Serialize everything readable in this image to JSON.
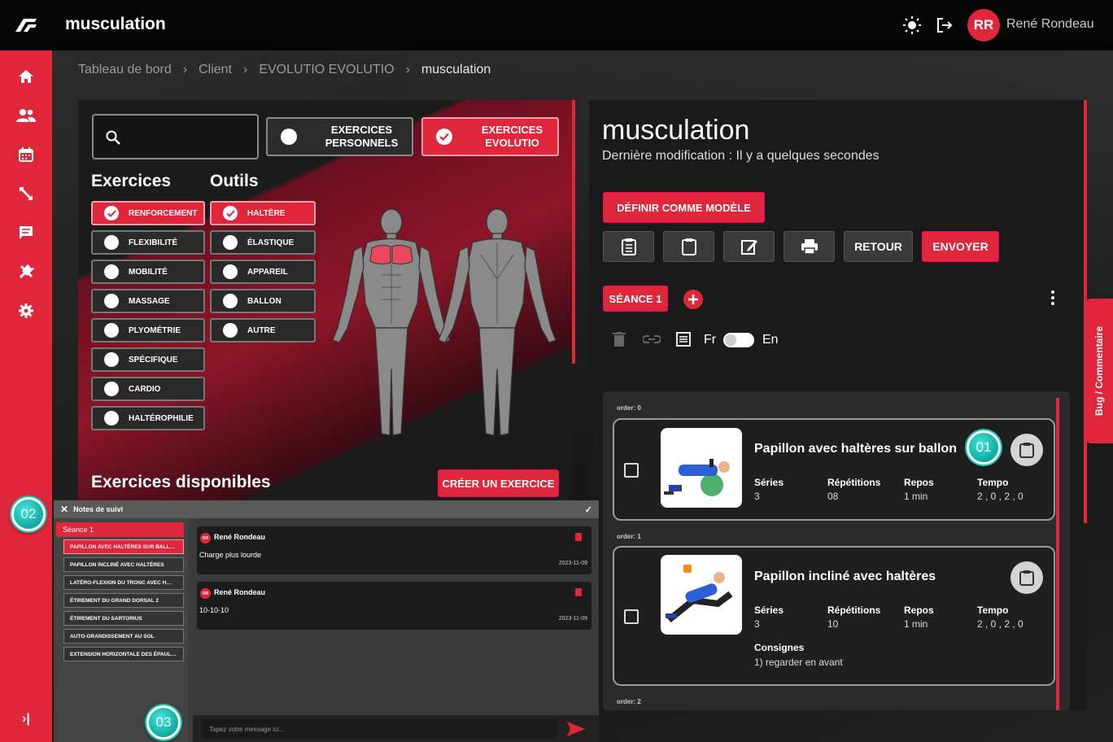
{
  "app": {
    "name": "musculation",
    "user_initials": "RR",
    "user_name": "René Rondeau"
  },
  "icons": {
    "logo": "brand-logo",
    "theme": "sun-icon",
    "logout": "logout-icon"
  },
  "sidebar": {
    "items": [
      {
        "icon": "home-icon"
      },
      {
        "icon": "clients-icon"
      },
      {
        "icon": "calendar-icon"
      },
      {
        "icon": "resize-icon"
      },
      {
        "icon": "message-icon"
      },
      {
        "icon": "tools-icon"
      },
      {
        "icon": "settings-icon"
      }
    ],
    "collapse": "›|"
  },
  "breadcrumb": [
    "Tableau de bord",
    "Client",
    "EVOLUTIO EVOLUTIO",
    "musculation"
  ],
  "breadcrumb_sep": "›",
  "library": {
    "toggle_personal": "EXERCICES PERSONNELS",
    "toggle_evolutio": "EXERCICES EVOLUTIO",
    "exercices_title": "Exercices",
    "outils_title": "Outils",
    "exercices": [
      {
        "label": "RENFORCEMENT",
        "checked": true
      },
      {
        "label": "FLEXIBILITÉ",
        "checked": false
      },
      {
        "label": "MOBILITÉ",
        "checked": false
      },
      {
        "label": "MASSAGE",
        "checked": false
      },
      {
        "label": "PLYOMÉTRIE",
        "checked": false
      },
      {
        "label": "SPÉCIFIQUE",
        "checked": false
      },
      {
        "label": "CARDIO",
        "checked": false
      },
      {
        "label": "HALTÉROPHILIE",
        "checked": false
      }
    ],
    "outils": [
      {
        "label": "HALTÈRE",
        "checked": true
      },
      {
        "label": "ÉLASTIQUE",
        "checked": false
      },
      {
        "label": "APPAREIL",
        "checked": false
      },
      {
        "label": "BALLON",
        "checked": false
      },
      {
        "label": "AUTRE",
        "checked": false
      }
    ],
    "available_title": "Exercices disponibles",
    "create_button": "CRÉER UN EXERCICE"
  },
  "program": {
    "title": "musculation",
    "modified": "Dernière modification : Il y a quelques secondes",
    "set_template": "DÉFINIR COMME MODÈLE",
    "tool_icons": [
      "notes-list-icon",
      "clipboard-icon",
      "edit-icon",
      "print-icon"
    ],
    "back": "RETOUR",
    "send": "ENVOYER",
    "session_tab": "SÉANCE 1",
    "lang_fr": "Fr",
    "lang_en": "En",
    "exercises": [
      {
        "order": "order: 0",
        "title": "Papillon avec haltères sur ballon",
        "series_label": "Séries",
        "series": "3",
        "reps_label": "Répétitions",
        "reps": "08",
        "rest_label": "Repos",
        "rest": "1 min",
        "tempo_label": "Tempo",
        "tempo": "2 , 0 , 2 , 0"
      },
      {
        "order": "order: 1",
        "title": "Papillon incliné avec haltères",
        "series_label": "Séries",
        "series": "3",
        "reps_label": "Répétitions",
        "reps": "10",
        "rest_label": "Repos",
        "rest": "1 min",
        "tempo_label": "Tempo",
        "tempo": "2 , 0 , 2 , 0",
        "instructions_label": "Consignes",
        "instructions": "1) regarder en avant"
      }
    ],
    "next_order": "order: 2"
  },
  "bug_tab": "Bug / Commentaire",
  "notes": {
    "title": "Notes de suivi",
    "session": "Séance 1",
    "items": [
      "PAPILLON AVEC HALTÈRES SUR BALL…",
      "PAPILLON INCLINÉ AVEC HALTÈRES",
      "LATÉRO-FLEXION DU TRONC AVEC H…",
      "ÉTIREMENT DU GRAND DORSAL 2",
      "ÉTIREMENT DU SARTORIUS",
      "AUTO-GRANDISSEMENT AU SOL",
      "EXTENSION HORIZONTALE DES ÉPAUL…"
    ],
    "messages": [
      {
        "avatar": "RR",
        "author": "René Rondeau",
        "text": "Charge plus lourde",
        "date": "2023-11-09"
      },
      {
        "avatar": "RR",
        "author": "René Rondeau",
        "text": "10-10-10",
        "date": "2023-11-09"
      }
    ],
    "input_placeholder": "Tapez votre message ici..."
  },
  "markers": [
    "01",
    "02",
    "03"
  ],
  "colors": {
    "accent": "#e0263a",
    "marker": "#16b7ae"
  }
}
